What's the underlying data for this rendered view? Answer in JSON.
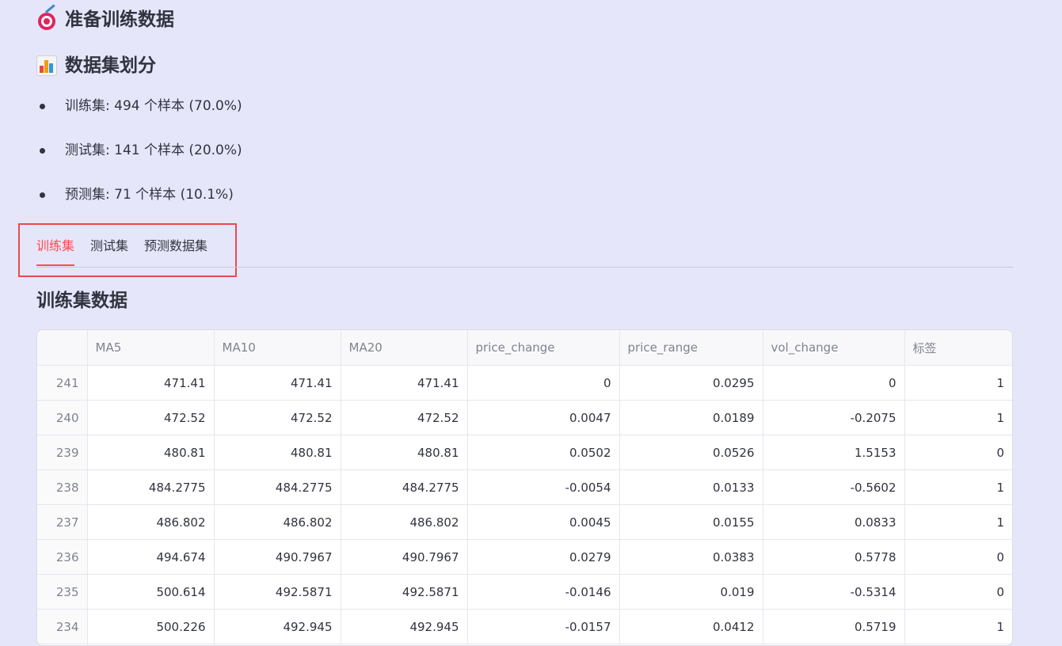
{
  "header": {
    "title": "准备训练数据",
    "subtitle": "数据集划分"
  },
  "stats": [
    "训练集: 494 个样本 (70.0%)",
    "测试集: 141 个样本 (20.0%)",
    "预测集: 71 个样本 (10.1%)"
  ],
  "tabs": [
    {
      "label": "训练集",
      "active": true
    },
    {
      "label": "测试集",
      "active": false
    },
    {
      "label": "预测数据集",
      "active": false
    }
  ],
  "colors": {
    "accent": "#ff4b4b",
    "highlight_box": "#e84a4f",
    "background": "#e6e6fa"
  },
  "section": {
    "title": "训练集数据"
  },
  "table": {
    "columns": [
      "",
      "MA5",
      "MA10",
      "MA20",
      "price_change",
      "price_range",
      "vol_change",
      "标签"
    ],
    "rows": [
      [
        "241",
        "471.41",
        "471.41",
        "471.41",
        "0",
        "0.0295",
        "0",
        "1"
      ],
      [
        "240",
        "472.52",
        "472.52",
        "472.52",
        "0.0047",
        "0.0189",
        "-0.2075",
        "1"
      ],
      [
        "239",
        "480.81",
        "480.81",
        "480.81",
        "0.0502",
        "0.0526",
        "1.5153",
        "0"
      ],
      [
        "238",
        "484.2775",
        "484.2775",
        "484.2775",
        "-0.0054",
        "0.0133",
        "-0.5602",
        "1"
      ],
      [
        "237",
        "486.802",
        "486.802",
        "486.802",
        "0.0045",
        "0.0155",
        "0.0833",
        "1"
      ],
      [
        "236",
        "494.674",
        "490.7967",
        "490.7967",
        "0.0279",
        "0.0383",
        "0.5778",
        "0"
      ],
      [
        "235",
        "500.614",
        "492.5871",
        "492.5871",
        "-0.0146",
        "0.019",
        "-0.5314",
        "0"
      ],
      [
        "234",
        "500.226",
        "492.945",
        "492.945",
        "-0.0157",
        "0.0412",
        "0.5719",
        "1"
      ]
    ]
  }
}
